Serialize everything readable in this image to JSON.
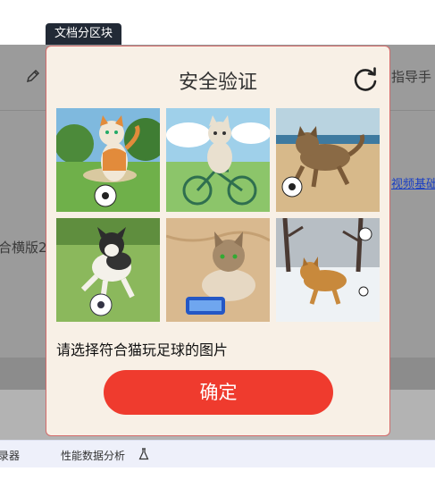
{
  "tag": {
    "label": "文档分区块"
  },
  "background": {
    "right_label": "指导手",
    "left_label": "合横版2",
    "link_label": "视频基础",
    "bottom_left": "录器",
    "bottom_mid": "性能数据分析"
  },
  "dialog": {
    "title": "安全验证",
    "prompt": "请选择符合猫玩足球的图片",
    "confirm_label": "确定",
    "images": [
      {
        "desc": "cartoon cat kicking soccer ball"
      },
      {
        "desc": "cartoon cat riding bicycle"
      },
      {
        "desc": "tabby cat running with soccer ball on beach"
      },
      {
        "desc": "dog running with soccer ball"
      },
      {
        "desc": "cat lying on sand with phone"
      },
      {
        "desc": "cat playing in snow with ball"
      }
    ]
  },
  "colors": {
    "accent": "#ef3b2e",
    "dialog_bg": "#f8f0e6",
    "tag_bg": "#222a36"
  }
}
